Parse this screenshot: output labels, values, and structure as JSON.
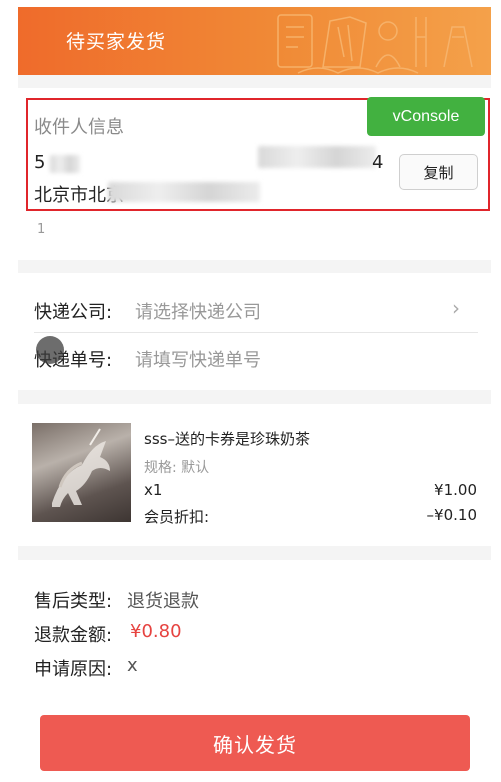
{
  "header": {
    "title": "待买家发货"
  },
  "vconsole": {
    "label": "vConsole"
  },
  "recipient": {
    "section_title": "收件人信息",
    "name_visible": "5",
    "phone_visible": "4",
    "address_visible": "北京市北京",
    "copy_button": "复制",
    "footnote": "1"
  },
  "express": {
    "company_label": "快递公司:",
    "company_placeholder": "请选择快递公司",
    "company_chevron_icon": "chevron-right-icon",
    "tracking_label": "快递单号:",
    "tracking_placeholder": "请填写快递单号"
  },
  "product": {
    "name": "sss–送的卡券是珍珠奶茶",
    "spec": "规格: 默认",
    "quantity": "x1",
    "price": "¥1.00",
    "discount_label": "会员折扣:",
    "discount_value": "–¥0.10"
  },
  "after_sale": {
    "type_label": "售后类型:",
    "type_value": "退货退款",
    "amount_label": "退款金额:",
    "amount_value": "¥0.80",
    "reason_label": "申请原因:",
    "reason_value": "x"
  },
  "footer": {
    "confirm_button": "确认发货"
  },
  "colors": {
    "header_orange": "#ef6b2b",
    "highlight_red": "#e0252b",
    "vconsole_green": "#42b140",
    "price_red": "#e64340",
    "confirm_button": "#ee5a52"
  }
}
